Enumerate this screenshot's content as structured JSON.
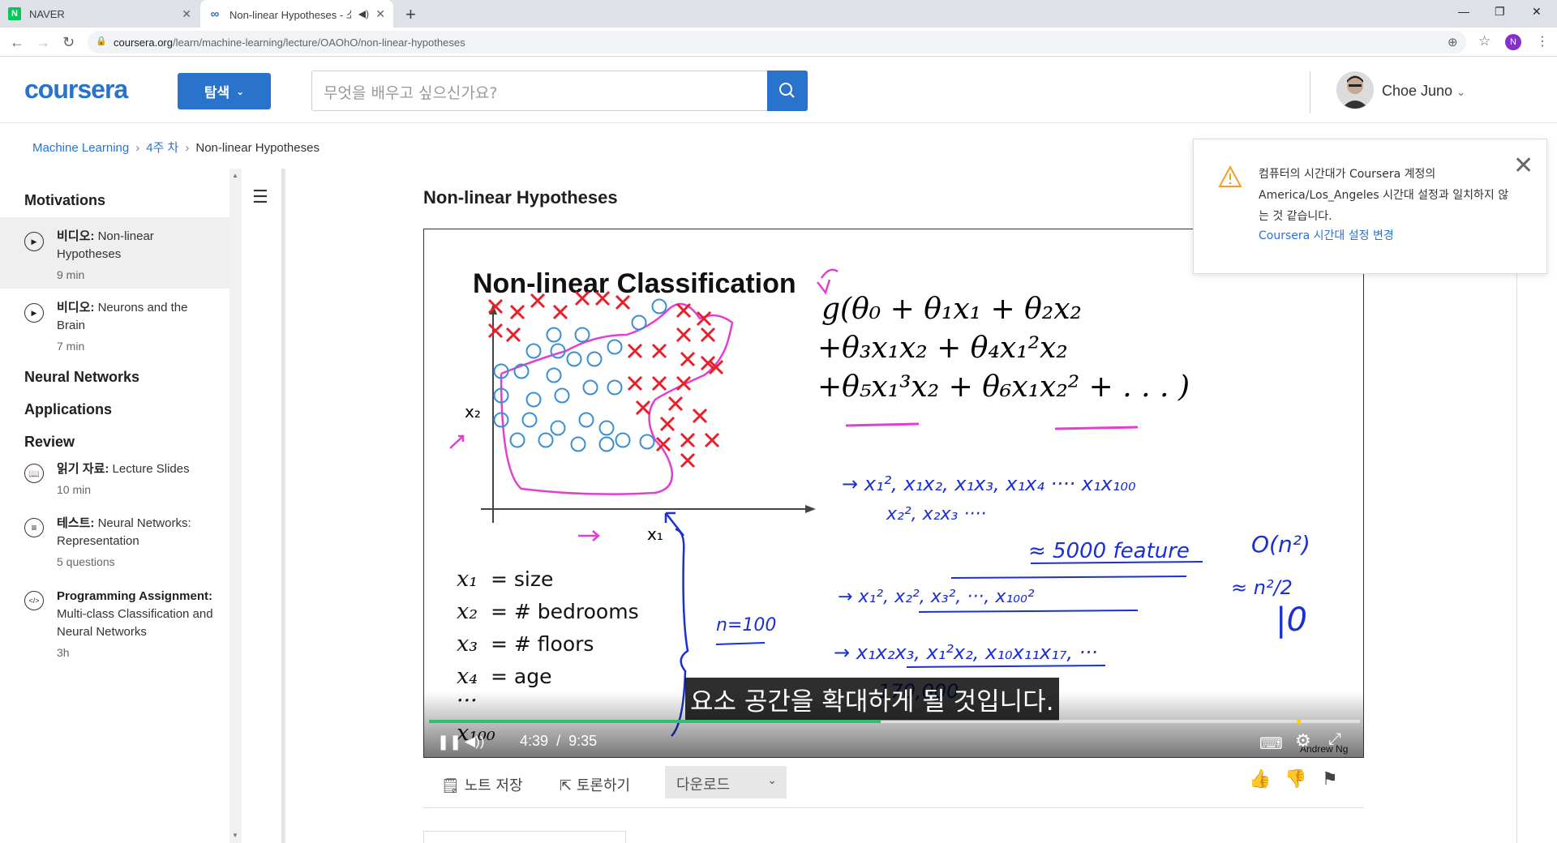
{
  "browser": {
    "tabs": [
      {
        "title": "NAVER",
        "favicon": "N"
      },
      {
        "title": "Non-linear Hypotheses - 소",
        "favicon": "∞"
      }
    ],
    "url_host": "coursera.org",
    "url_path": "/learn/machine-learning/lecture/OAOhO/non-linear-hypotheses",
    "profile_initial": "N"
  },
  "header": {
    "logo": "coursera",
    "explore_label": "탐색",
    "search_placeholder": "무엇을 배우고 싶으신가요?",
    "user_name": "Choe Juno"
  },
  "breadcrumb": {
    "course": "Machine Learning",
    "week": "4주 차",
    "current": "Non-linear Hypotheses"
  },
  "sidebar": {
    "sections": [
      "Motivations",
      "Neural Networks",
      "Applications",
      "Review"
    ],
    "items": [
      {
        "kind": "비디오:",
        "title": "Non-linear Hypotheses",
        "meta": "9 min"
      },
      {
        "kind": "비디오:",
        "title": "Neurons and the Brain",
        "meta": "7 min"
      },
      {
        "kind": "읽기 자료:",
        "title": "Lecture Slides",
        "meta": "10 min"
      },
      {
        "kind": "테스트:",
        "title": "Neural Networks: Representation",
        "meta": "5 questions"
      },
      {
        "kind": "Programming Assignment:",
        "title": "Multi-class Classification and Neural Networks",
        "meta": "3h"
      }
    ]
  },
  "lecture": {
    "title": "Non-linear Hypotheses",
    "slide_title": "Non-linear Classification",
    "slide_author": "Andrew Ng",
    "features": [
      "= size",
      "= # bedrooms",
      "= # floors",
      "= age"
    ],
    "subtitle": "요소 공간을 확대하게 될 것입니다.",
    "time_current": "4:39",
    "time_separator": "/",
    "time_total": "9:35",
    "progress": 0.485,
    "handwriting": {
      "n": "n=100",
      "approx": "≈ 5000 feature",
      "order": "O(n²)",
      "n2over2": "≈ n²/2",
      "big": "170,000"
    }
  },
  "actions": {
    "save_note": "노트 저장",
    "discuss": "토론하기",
    "download": "다운로드"
  },
  "toast": {
    "message": "컴퓨터의 시간대가 Coursera 계정의 America/Los_Angeles 시간대 설정과 일치하지 않는 것 같습니다.",
    "link": "Coursera 시간대 설정 변경"
  },
  "colors": {
    "brand": "#2a73cc",
    "progress": "#2fc06b",
    "cross": "#e8202a",
    "circle": "#3a8fd4",
    "boundary": "#e23fd2",
    "ink": "#1a2fd6"
  }
}
